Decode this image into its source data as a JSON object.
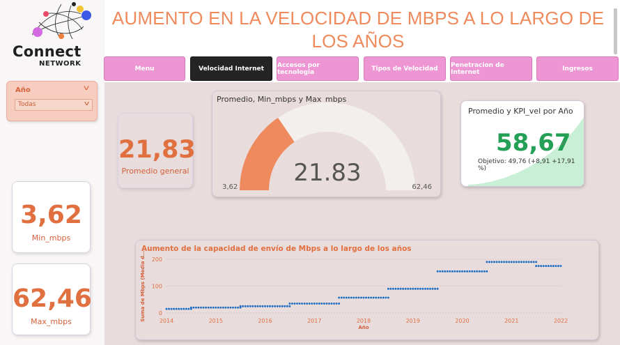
{
  "brand": {
    "name": "Connect",
    "sub": "NETWORK"
  },
  "header": {
    "title_line1": "AUMENTO EN LA VELOCIDAD DE MBPS A LO LARGO DE",
    "title_line2": "LOS AÑOS"
  },
  "nav": {
    "items": [
      {
        "label": "Menu",
        "active": false
      },
      {
        "label": "Velocidad Internet",
        "active": true
      },
      {
        "label": "Accesos por tecnologia",
        "active": false
      },
      {
        "label": "Tipos de Velocidad",
        "active": false
      },
      {
        "label": "Penetracion de Internet",
        "active": false
      },
      {
        "label": "Ingresos",
        "active": false
      }
    ]
  },
  "slicer": {
    "title": "Año",
    "value": "Todas"
  },
  "cards": {
    "promedio": {
      "value": "21,83",
      "label": "Promedio general"
    },
    "min": {
      "value": "3,62",
      "label": "Min_mbps"
    },
    "max": {
      "value": "62,46",
      "label": "Max_mbps"
    }
  },
  "gauge": {
    "title": "Promedio, Min_mbps y Max_mbps",
    "value_text": "21.83",
    "min_text": "3,62",
    "max_text": "62,46",
    "value": 21.83,
    "min": 3.62,
    "max": 62.46,
    "fill_color": "#ef8a5e",
    "track_color": "#f2efee"
  },
  "kpi": {
    "title": "Promedio y KPI_vel por Año",
    "value": "58,67",
    "goal_text": "Objetivo: 49,76 (+8,91 +17,91 %)",
    "trend_color": "#c9efd6"
  },
  "chart_data": {
    "type": "line",
    "title": "Aumento de la capacidad de envío de Mbps a lo largo de los años",
    "xlabel": "Año",
    "ylabel": "Suma de Mbps (Media d...",
    "xlim": [
      2014,
      2022
    ],
    "ylim": [
      0,
      200
    ],
    "yticks": [
      0,
      100,
      200
    ],
    "xticks": [
      "2014",
      "2015",
      "2016",
      "2017",
      "2018",
      "2019",
      "2020",
      "2021",
      "2022"
    ],
    "color": "#1f6ec2",
    "series": [
      {
        "x": [
          2014.0,
          2014.5,
          2014.5,
          2015.5,
          2015.5,
          2016.5,
          2016.5,
          2017.5,
          2017.5,
          2018.5,
          2018.5,
          2019.5,
          2019.5,
          2020.5,
          2020.5,
          2021.5,
          2021.5,
          2022.0
        ],
        "y": [
          15,
          15,
          20,
          20,
          25,
          25,
          35,
          35,
          57,
          57,
          90,
          90,
          155,
          155,
          190,
          190,
          175,
          175
        ]
      }
    ]
  }
}
